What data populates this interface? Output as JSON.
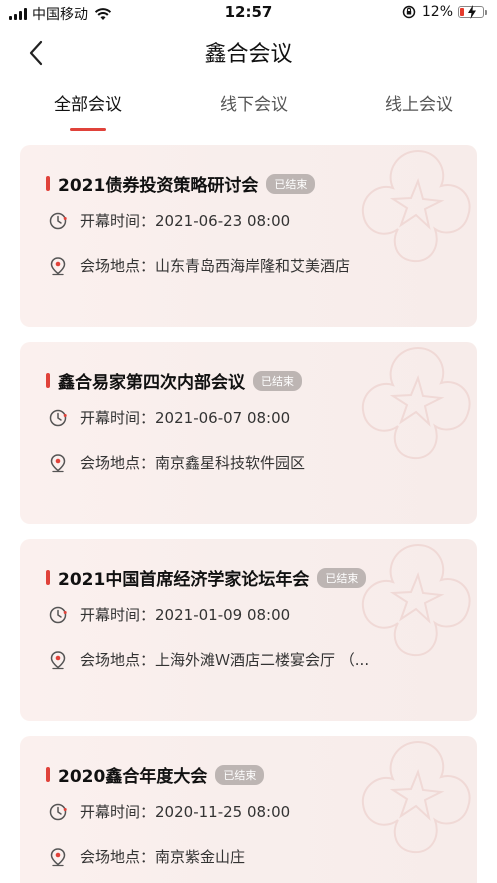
{
  "status_bar": {
    "carrier": "中国移动",
    "time": "12:57",
    "battery_percent": "12%"
  },
  "nav": {
    "title": "鑫合会议"
  },
  "tabs": [
    {
      "label": "全部会议",
      "active": true
    },
    {
      "label": "线下会议",
      "active": false
    },
    {
      "label": "线上会议",
      "active": false
    }
  ],
  "colors": {
    "accent": "#e0423a",
    "card_bg": "#f8eeec",
    "badge_bg": "#bdb5b3"
  },
  "meetings": [
    {
      "title": "2021债券投资策略研讨会",
      "status": "已结束",
      "time_label": "开幕时间：",
      "time": "2021-06-23 08:00",
      "place_label": "会场地点：",
      "place": "山东青岛西海岸隆和艾美酒店"
    },
    {
      "title": "鑫合易家第四次内部会议",
      "status": "已结束",
      "time_label": "开幕时间：",
      "time": "2021-06-07 08:00",
      "place_label": "会场地点：",
      "place": "南京鑫星科技软件园区"
    },
    {
      "title": "2021中国首席经济学家论坛年会",
      "status": "已结束",
      "time_label": "开幕时间：",
      "time": "2021-01-09 08:00",
      "place_label": "会场地点：",
      "place": "上海外滩Ｗ酒店二楼宴会厅 （..."
    },
    {
      "title": "2020鑫合年度大会",
      "status": "已结束",
      "time_label": "开幕时间：",
      "time": "2020-11-25 08:00",
      "place_label": "会场地点：",
      "place": "南京紫金山庄"
    }
  ]
}
